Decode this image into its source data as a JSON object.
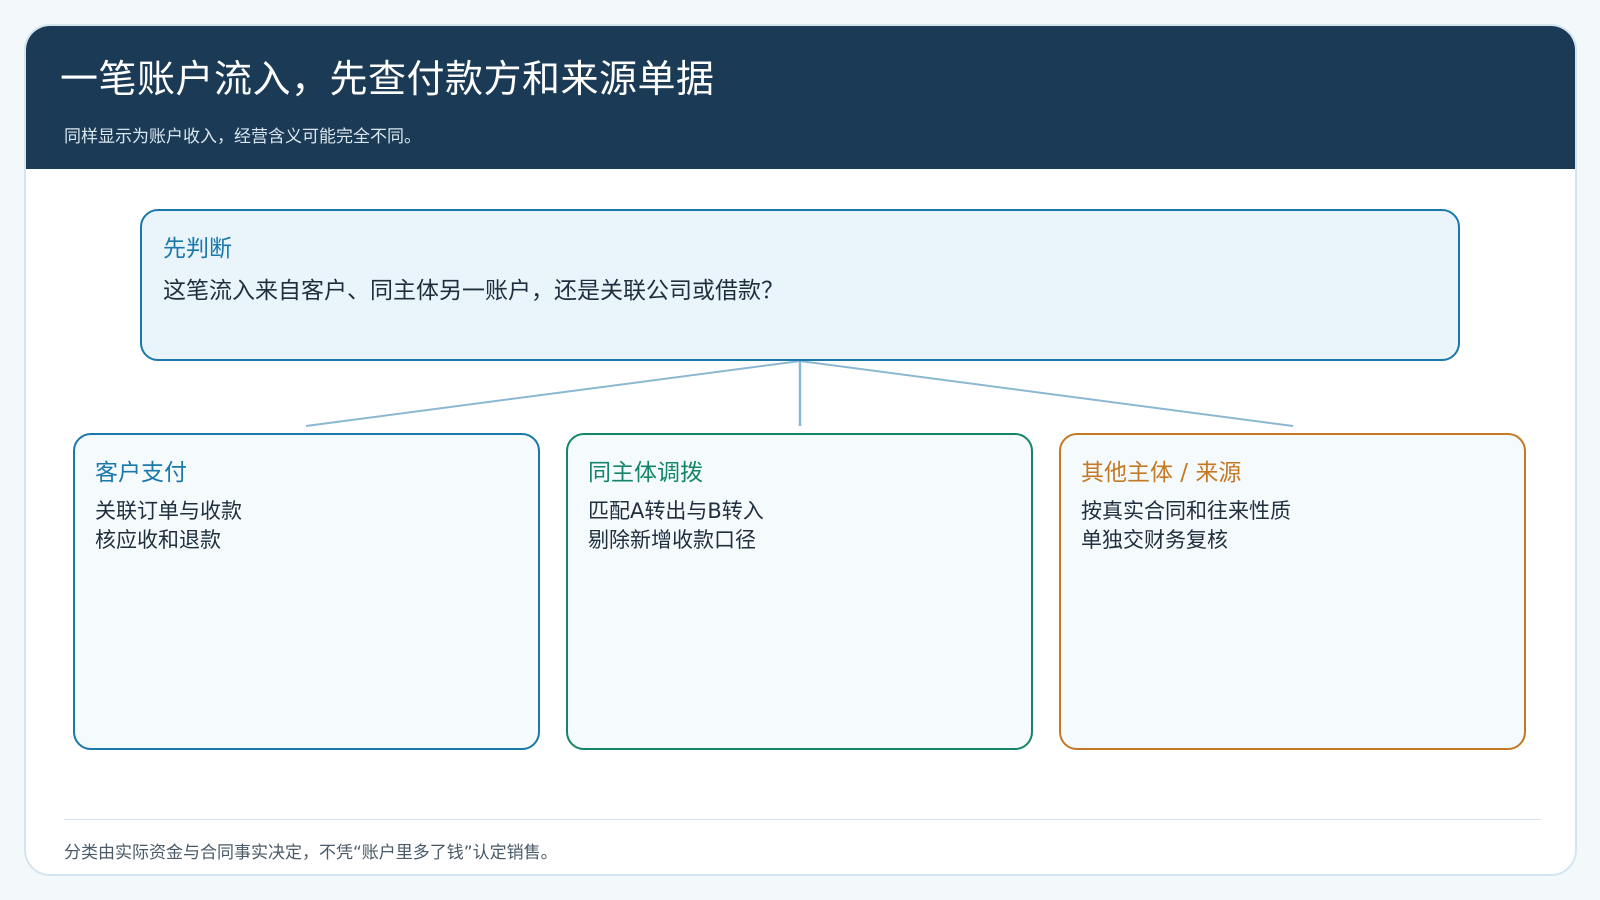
{
  "header": {
    "title": "一笔账户流入，先查付款方和来源单据",
    "subtitle": "同样显示为账户收入，经营含义可能完全不同。"
  },
  "question": {
    "title": "先判断",
    "text": "这笔流入来自客户、同主体另一账户，还是关联公司或借款？"
  },
  "branches": [
    {
      "title": "客户支付",
      "lines": [
        "关联订单与收款",
        "核应收和退款"
      ],
      "color": "#1a78ab"
    },
    {
      "title": "同主体调拨",
      "lines": [
        "匹配A转出与B转入",
        "剔除新增收款口径"
      ],
      "color": "#14856b"
    },
    {
      "title": "其他主体 / 来源",
      "lines": [
        "按真实合同和往来性质",
        "单独交财务复核"
      ],
      "color": "#c47a24"
    }
  ],
  "footer": {
    "note": "分类由实际资金与合同事实决定，不凭“账户里多了钱”认定销售。"
  },
  "colors": {
    "header_bg": "#1a3a55",
    "connector": "#8bb8d1"
  }
}
